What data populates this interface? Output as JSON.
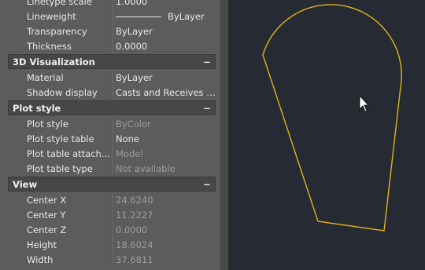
{
  "properties_top": [
    {
      "name": "Linetype scale",
      "value": "1.0000"
    },
    {
      "name": "Lineweight",
      "value": "ByLayer",
      "swatch": true
    },
    {
      "name": "Transparency",
      "value": "ByLayer"
    },
    {
      "name": "Thickness",
      "value": "0.0000"
    }
  ],
  "sections": {
    "visualization": {
      "title": "3D Visualization",
      "toggle": "−",
      "rows": [
        {
          "name": "Material",
          "value": "ByLayer"
        },
        {
          "name": "Shadow display",
          "value": "Casts and Receives Sh..."
        }
      ]
    },
    "plot_style": {
      "title": "Plot style",
      "toggle": "−",
      "rows": [
        {
          "name": "Plot style",
          "value": "ByColor",
          "readonly": true
        },
        {
          "name": "Plot style table",
          "value": "None"
        },
        {
          "name": "Plot table attach...",
          "value": "Model",
          "readonly": true
        },
        {
          "name": "Plot table type",
          "value": "Not available",
          "readonly": true
        }
      ]
    },
    "view": {
      "title": "View",
      "toggle": "−",
      "rows": [
        {
          "name": "Center X",
          "value": "24.6240",
          "readonly": true
        },
        {
          "name": "Center Y",
          "value": "11.2227",
          "readonly": true
        },
        {
          "name": "Center Z",
          "value": "0.0000",
          "readonly": true
        },
        {
          "name": "Height",
          "value": "18.6024",
          "readonly": true
        },
        {
          "name": "Width",
          "value": "37.6811",
          "readonly": true
        }
      ]
    }
  },
  "viewport": {
    "background": "#262b33",
    "shape_color": "#e0b21a",
    "cursor_icon": "arrow-cursor-icon"
  }
}
